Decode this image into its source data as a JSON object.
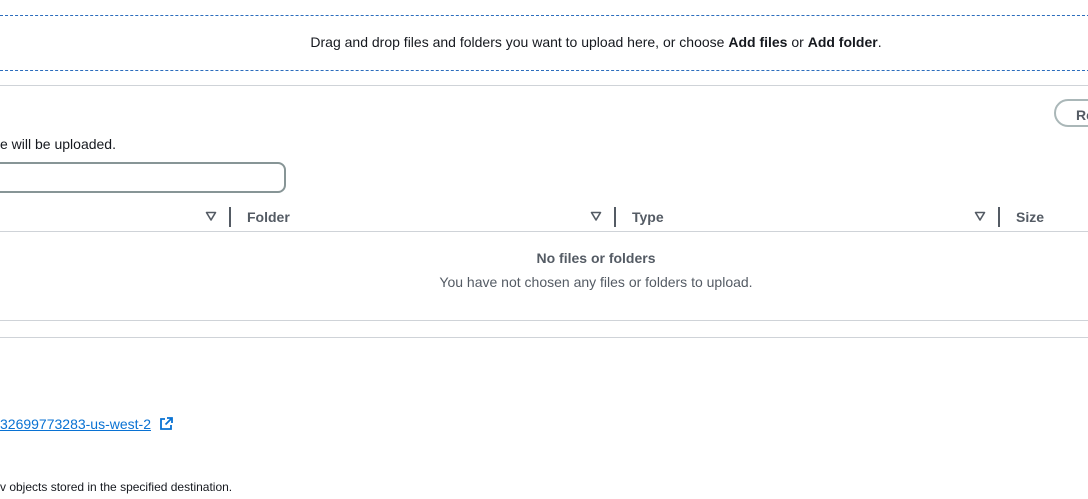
{
  "dropzone": {
    "prefix": "Drag and drop files and folders you want to upload here, or choose ",
    "add_files": "Add files",
    "middle": " or ",
    "add_folder": "Add folder",
    "suffix": "."
  },
  "files_panel": {
    "remove_button": "Re",
    "description": "e will be uploaded.",
    "search_value": "",
    "columns": [
      "Folder",
      "Type",
      "Size"
    ],
    "empty_title": "No files or folders",
    "empty_message": "You have not chosen any files or folders to upload."
  },
  "destination": {
    "bucket_link": "32699773283-us-west-2",
    "note": "v objects stored in the specified destination."
  },
  "icons": {
    "sort": "caret-down-icon",
    "external": "external-link-icon"
  },
  "colors": {
    "link": "#0972d3",
    "dropzone_border": "#2c6dbd",
    "muted_text": "#545b64"
  }
}
